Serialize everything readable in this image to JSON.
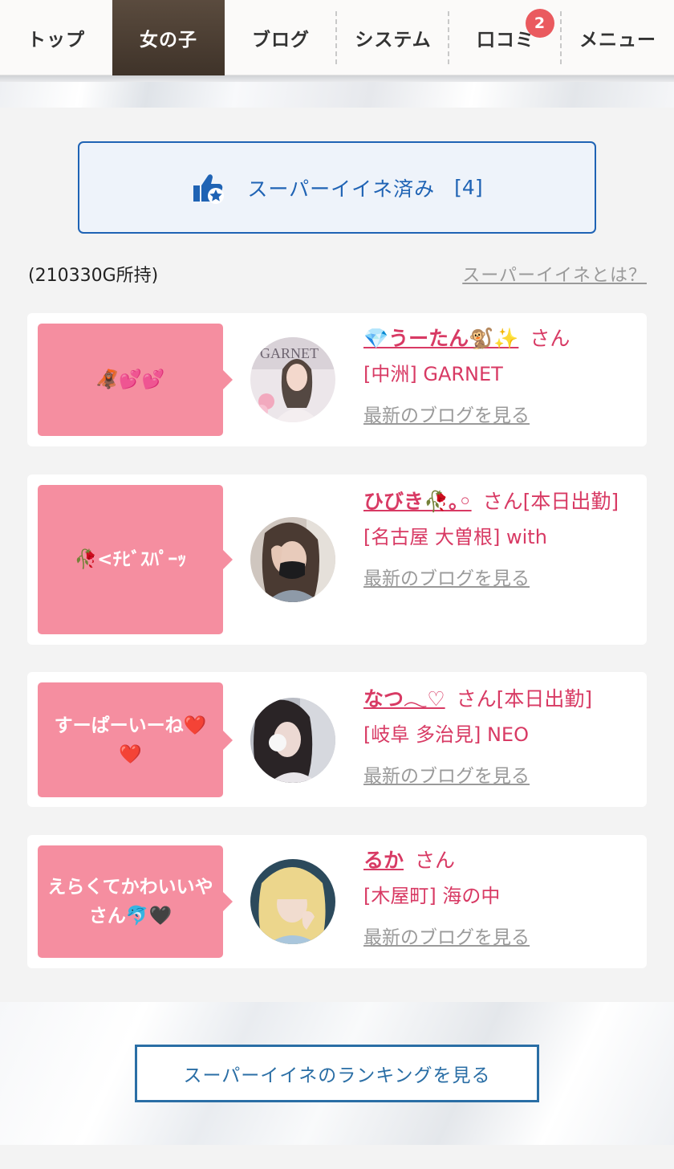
{
  "nav": {
    "tabs": [
      {
        "label": "トップ"
      },
      {
        "label": "女の子"
      },
      {
        "label": "ブログ"
      },
      {
        "label": "システム"
      },
      {
        "label": "口コミ",
        "badge": "2"
      },
      {
        "label": "メニュー"
      }
    ],
    "active_index": 1
  },
  "super_iine": {
    "label": "スーパーイイネ済み",
    "count": "[4]",
    "icon": "thumbs-up-star-icon",
    "color": "#1f63b4"
  },
  "gold": "(210330G所持)",
  "what_is_link": "スーパーイイネとは？",
  "cards": [
    {
      "message": "🦧💕💕",
      "name": "💎うーたん🐒✨",
      "honorific": "さん",
      "status": "",
      "shop": "[中洲] GARNET",
      "blog_link": "最新のブログを見る"
    },
    {
      "message": "🥀<ﾁﾋﾞｽﾊﾟｰｯ",
      "name": "ひびき🥀｡◦",
      "honorific": "さん",
      "status": "[本日出勤]",
      "shop": "[名古屋 大曽根] with",
      "blog_link": "最新のブログを見る"
    },
    {
      "message": "すーぱーいーね❤️❤️",
      "name": "なつ𓂃♡",
      "honorific": "さん",
      "status": "[本日出勤]",
      "shop": "[岐阜 多治見] NEO",
      "blog_link": "最新のブログを見る"
    },
    {
      "message": "えらくてかわいいやさん🐬🖤",
      "name": "るか",
      "honorific": "さん",
      "status": "",
      "shop": "[木屋町] 海の中",
      "blog_link": "最新のブログを見る"
    }
  ],
  "ranking_button": "スーパーイイネのランキングを見る",
  "colors": {
    "accent_pink": "#d83a64",
    "bubble_pink": "#f58ea0",
    "active_tab": "#4d3f33",
    "badge": "#ea5a5f"
  }
}
